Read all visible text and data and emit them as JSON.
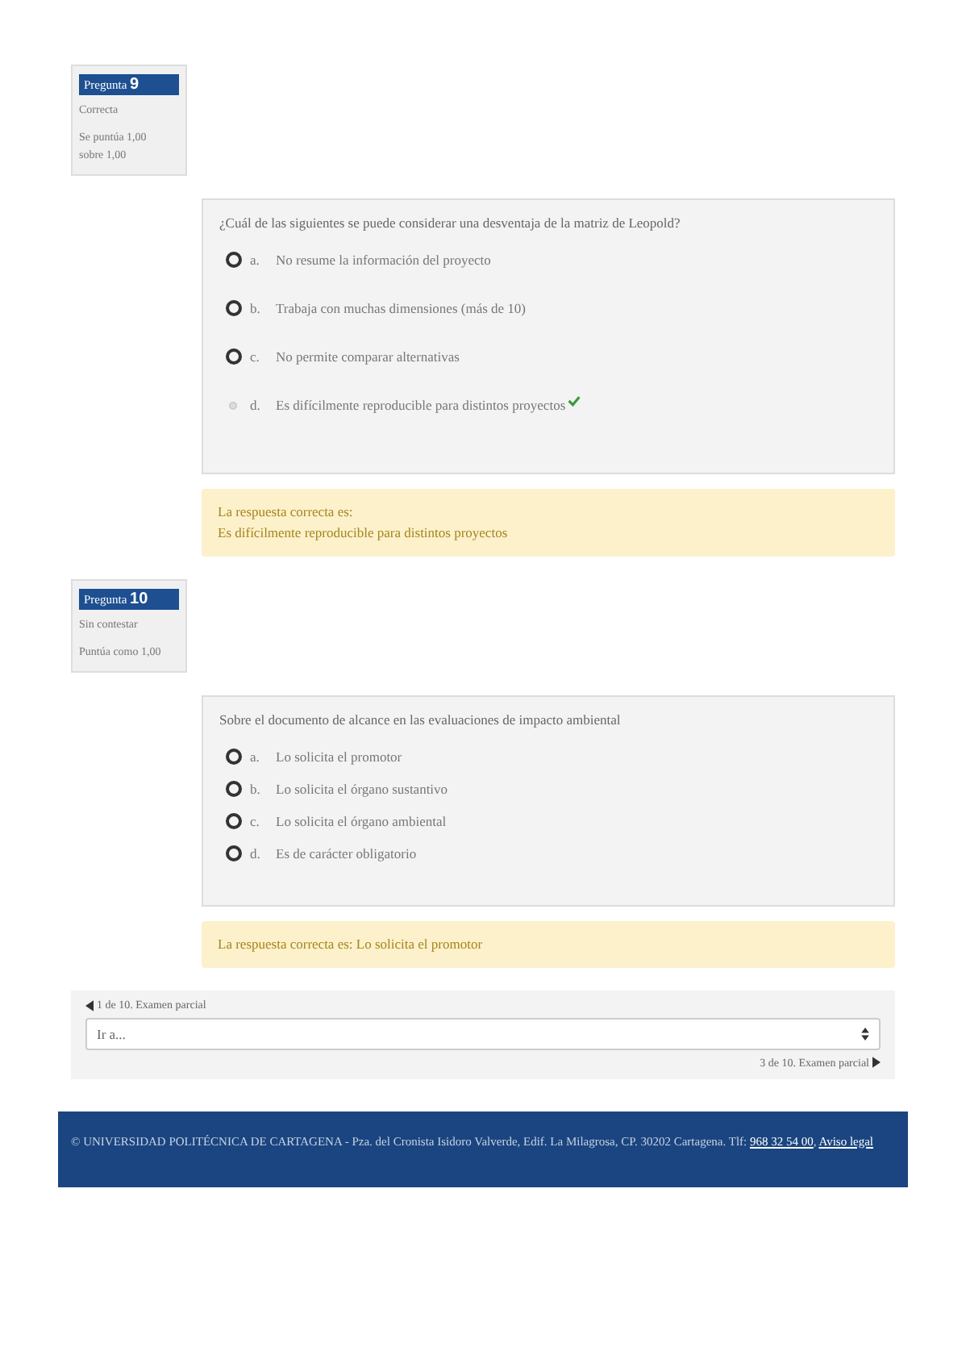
{
  "questions": [
    {
      "number_label": "Pregunta",
      "number": "9",
      "state": "Correcta",
      "grade_lines": [
        "Se puntúa 1,00",
        "sobre 1,00"
      ],
      "text": "¿Cuál de las siguientes se puede considerar una desventaja de la matriz de Leopold?",
      "options": [
        {
          "letter": "a.",
          "text": "No resume la información del proyecto",
          "selected": false,
          "correct": false
        },
        {
          "letter": "b.",
          "text": "Trabaja con muchas dimensiones (más de 10)",
          "selected": false,
          "correct": false
        },
        {
          "letter": "c.",
          "text": "No permite comparar alternativas",
          "selected": false,
          "correct": false
        },
        {
          "letter": "d.",
          "text": "Es difícilmente reproducible para distintos proyectos",
          "selected": true,
          "correct": true
        }
      ],
      "feedback_lines": [
        "La respuesta correcta es:",
        "Es difícilmente reproducible para distintos proyectos"
      ]
    },
    {
      "number_label": "Pregunta",
      "number": "10",
      "state": "Sin contestar",
      "grade_lines": [
        "Puntúa como 1,00"
      ],
      "text": "Sobre el documento de alcance en las evaluaciones de impacto ambiental",
      "options": [
        {
          "letter": "a.",
          "text": "Lo solicita el promotor",
          "selected": false,
          "correct": false
        },
        {
          "letter": "b.",
          "text": "Lo solicita el órgano sustantivo",
          "selected": false,
          "correct": false
        },
        {
          "letter": "c.",
          "text": "Lo solicita el órgano ambiental",
          "selected": false,
          "correct": false
        },
        {
          "letter": "d.",
          "text": "Es de carácter obligatorio",
          "selected": false,
          "correct": false
        }
      ],
      "feedback_lines": [
        "La respuesta correcta es: Lo solicita el promotor"
      ]
    }
  ],
  "navigation": {
    "previous": "1 de 10. Examen parcial",
    "jump_placeholder": "Ir a...",
    "next": "3 de 10. Examen parcial"
  },
  "footer": {
    "text": "© UNIVERSIDAD POLITÉCNICA DE CARTAGENA - Pza. del Cronista Isidoro Valverde, Edif. La Milagrosa, CP. 30202 Cartagena. Tlf:",
    "phone": "968 32 54 00",
    "separator": ",",
    "legal": "Aviso legal"
  }
}
